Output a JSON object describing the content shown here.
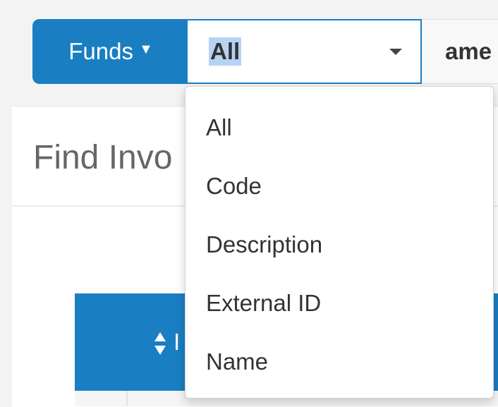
{
  "search_bar": {
    "scope_button_label": "Funds",
    "field_select_value": "All",
    "search_text": "ame"
  },
  "panel": {
    "title": "Find Invo"
  },
  "table": {
    "header_label": "I"
  },
  "dropdown": {
    "options": [
      "All",
      "Code",
      "Description",
      "External ID",
      "Name"
    ]
  },
  "colors": {
    "accent": "#1a7ec2",
    "selection": "#b5d3f3"
  }
}
